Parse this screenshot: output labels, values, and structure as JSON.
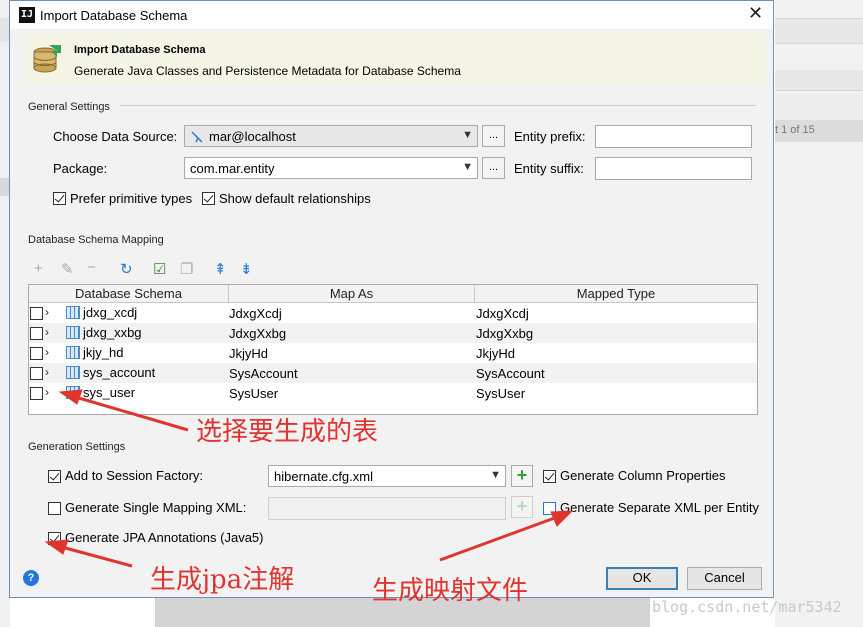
{
  "window": {
    "title": "Import Database Schema",
    "app_icon": "intellij-icon",
    "close_glyph": "✕"
  },
  "banner": {
    "title": "Import Database Schema",
    "subtitle": "Generate Java Classes and Persistence Metadata for Database Schema",
    "icon": "database-icon"
  },
  "general": {
    "section_title": "General Settings",
    "data_source_label": "Choose Data Source:",
    "data_source_value": "mar@localhost",
    "package_label": "Package:",
    "package_value": "com.mar.entity",
    "browse_label": "...",
    "entity_prefix_label": "Entity prefix:",
    "entity_prefix_value": "",
    "entity_suffix_label": "Entity suffix:",
    "entity_suffix_value": "",
    "prefer_primitive_label": "Prefer primitive types",
    "prefer_primitive_checked": true,
    "show_default_rel_label": "Show default relationships",
    "show_default_rel_checked": true
  },
  "mapping": {
    "section_title": "Database Schema Mapping",
    "toolbar": [
      "plus-icon",
      "edit-icon",
      "minus-icon",
      "refresh-icon",
      "check-all-icon",
      "copy-icon",
      "expand-all-icon",
      "collapse-all-icon"
    ],
    "columns": [
      "Database Schema",
      "Map As",
      "Mapped Type"
    ],
    "rows": [
      {
        "schema": "jdxg_xcdj",
        "map_as": "JdxgXcdj",
        "mapped_type": "JdxgXcdj",
        "checked": false
      },
      {
        "schema": "jdxg_xxbg",
        "map_as": "JdxgXxbg",
        "mapped_type": "JdxgXxbg",
        "checked": false
      },
      {
        "schema": "jkjy_hd",
        "map_as": "JkjyHd",
        "mapped_type": "JkjyHd",
        "checked": false
      },
      {
        "schema": "sys_account",
        "map_as": "SysAccount",
        "mapped_type": "SysAccount",
        "checked": false
      },
      {
        "schema": "sys_user",
        "map_as": "SysUser",
        "mapped_type": "SysUser",
        "checked": false
      }
    ]
  },
  "generation": {
    "section_title": "Generation Settings",
    "add_session_factory_label": "Add to Session Factory:",
    "add_session_factory_checked": true,
    "session_factory_value": "hibernate.cfg.xml",
    "single_mapping_label": "Generate Single Mapping XML:",
    "single_mapping_checked": false,
    "single_mapping_value": "",
    "jpa_annotations_label": "Generate JPA Annotations (Java5)",
    "jpa_annotations_checked": true,
    "column_props_label": "Generate Column Properties",
    "column_props_checked": true,
    "separate_xml_label": "Generate Separate XML per Entity",
    "separate_xml_checked": false
  },
  "footer": {
    "help": "?",
    "ok_label": "OK",
    "cancel_label": "Cancel"
  },
  "annotations": {
    "select_tables": "选择要生成的表",
    "generate_jpa": "生成jpa注解",
    "generate_mapping": "生成映射文件",
    "color": "#e0342f"
  },
  "background": {
    "pager_text": "t 1 of 15",
    "watermark": "blog.csdn.net/mar5342"
  }
}
